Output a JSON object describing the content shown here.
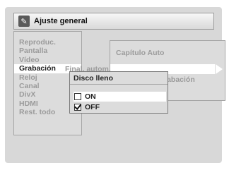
{
  "header": {
    "title": "Ajuste general",
    "icon": "wrench-icon"
  },
  "left_menu": {
    "items": [
      {
        "label": "Reproduc."
      },
      {
        "label": "Pantalla"
      },
      {
        "label": "Vídeo"
      },
      {
        "label": "Grabación"
      },
      {
        "label": "Reloj"
      },
      {
        "label": "Canal"
      },
      {
        "label": "DivX"
      },
      {
        "label": "HDMI"
      },
      {
        "label": "Rest. todo"
      }
    ],
    "selected": "Grabación"
  },
  "submenu": {
    "items": [
      {
        "label": "Capítulo Auto"
      },
      {
        "label": "Final. autom."
      },
      {
        "label": "rabación"
      }
    ]
  },
  "popup": {
    "title": "Disco lleno",
    "options": [
      {
        "label": "ON",
        "checked": false
      },
      {
        "label": "OFF",
        "checked": true
      }
    ]
  },
  "colors": {
    "background": "#d8d8d8",
    "highlight": "#ffffff",
    "inactive_text": "#9b9b9b",
    "active_text": "#222222"
  }
}
